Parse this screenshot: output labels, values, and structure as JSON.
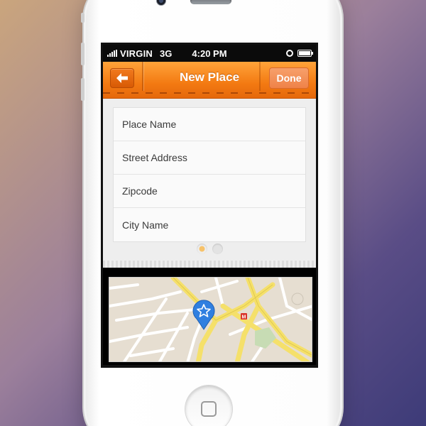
{
  "status_bar": {
    "carrier": "VIRGIN",
    "network": "3G",
    "time": "4:20 PM"
  },
  "nav_bar": {
    "title": "New Place",
    "done_label": "Done",
    "back_icon": "arrow-left-icon"
  },
  "form": {
    "fields": [
      {
        "placeholder": "Place Name"
      },
      {
        "placeholder": "Street Address"
      },
      {
        "placeholder": "Zipcode"
      },
      {
        "placeholder": "City Name"
      }
    ]
  },
  "pager": {
    "current_page": 1,
    "page_count": 2
  },
  "map": {
    "pin_icon": "star-icon",
    "marker_icon": "metro-icon",
    "pin_color": "#2f7fe0",
    "road_color": "#f5e06a"
  },
  "colors": {
    "accent": "#f37a12",
    "nav_bar_gradient_top": "#ffa33a"
  }
}
